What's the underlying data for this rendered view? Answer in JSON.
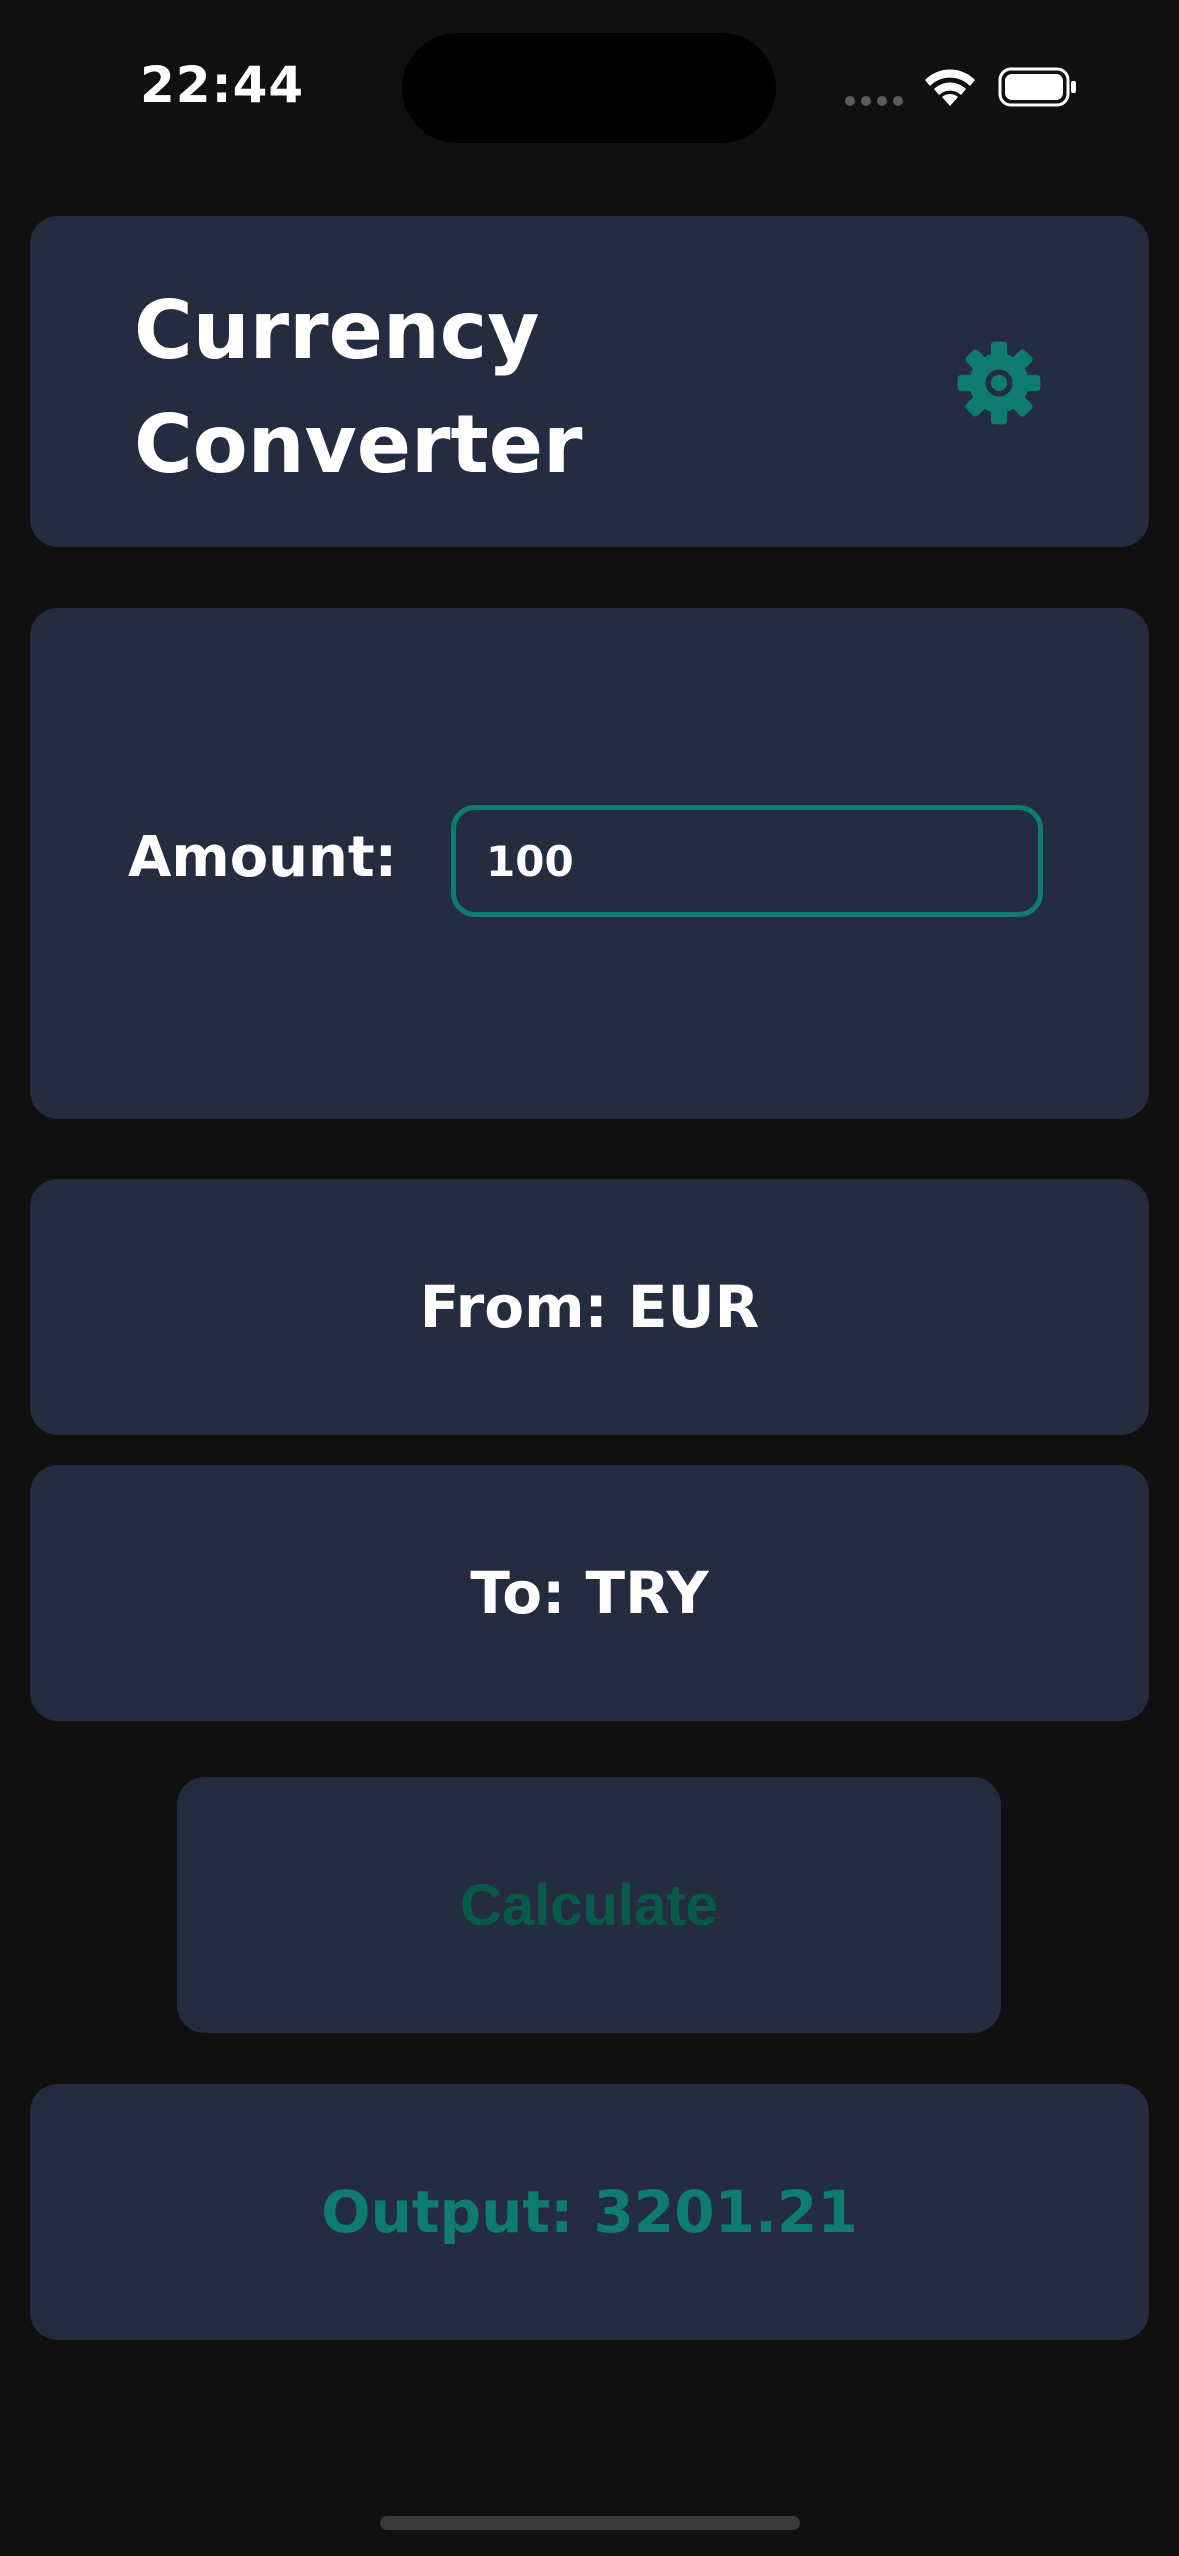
{
  "status_bar": {
    "time": "22:44",
    "icons": [
      "signal-dots-icon",
      "wifi-icon",
      "battery-icon"
    ]
  },
  "header": {
    "title_line1": "Currency",
    "title_line2": "Converter",
    "settings_icon": "gear-icon"
  },
  "amount": {
    "label": "Amount:",
    "value": "100"
  },
  "from": {
    "label": "From: EUR"
  },
  "to": {
    "label": "To: TRY"
  },
  "calculate": {
    "label": "Calculate"
  },
  "output": {
    "text": "Output: 3201.21"
  },
  "colors": {
    "background": "#101010",
    "card": "#242c3f",
    "accent": "#0e7d6f",
    "calculate_text": "#0a5a4c",
    "text": "#ffffff"
  }
}
